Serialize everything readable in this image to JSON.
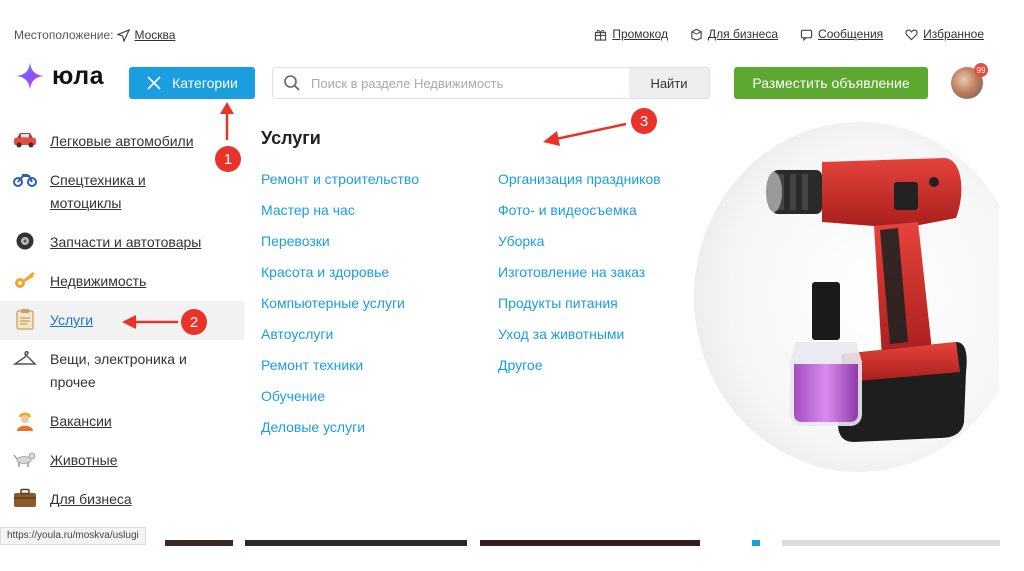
{
  "location": {
    "label": "Местоположение:",
    "city": "Москва"
  },
  "top_links": [
    {
      "label": "Промокод",
      "icon": "gift-icon"
    },
    {
      "label": "Для бизнеса",
      "icon": "briefcase-icon"
    },
    {
      "label": "Сообщения",
      "icon": "message-icon"
    },
    {
      "label": "Избранное",
      "icon": "heart-icon"
    }
  ],
  "header": {
    "logo": "юла",
    "categories_button": "Категории",
    "search_placeholder": "Поиск в разделе Недвижимость",
    "search_value": "",
    "find_button": "Найти",
    "post_button": "Разместить объявление",
    "avatar_badge": "99"
  },
  "sidebar": {
    "items": [
      {
        "label": "Легковые автомобили",
        "icon": "car-icon"
      },
      {
        "label": "Спецтехника и мотоциклы",
        "icon": "motorcycle-icon"
      },
      {
        "label": "Запчасти и автотовары",
        "icon": "tire-icon"
      },
      {
        "label": "Недвижимость",
        "icon": "key-icon"
      },
      {
        "label": "Услуги",
        "icon": "clipboard-icon",
        "active": true
      },
      {
        "label": "Вещи, электроника и прочее",
        "icon": "hanger-icon"
      },
      {
        "label": "Вакансии",
        "icon": "worker-icon"
      },
      {
        "label": "Животные",
        "icon": "dog-icon"
      },
      {
        "label": "Для бизнеса",
        "icon": "briefcase-icon"
      }
    ]
  },
  "category": {
    "title": "Услуги",
    "col1": [
      "Ремонт и строительство",
      "Мастер на час",
      "Перевозки",
      "Красота и здоровье",
      "Компьютерные услуги",
      "Автоуслуги",
      "Ремонт техники",
      "Обучение",
      "Деловые услуги"
    ],
    "col2": [
      "Организация праздников",
      "Фото- и видеосъемка",
      "Уборка",
      "Изготовление на заказ",
      "Продукты питания",
      "Уход за животными",
      "Другое"
    ]
  },
  "annotations": [
    "1",
    "2",
    "3"
  ],
  "status_url": "https://youla.ru/moskva/uslugi",
  "colors": {
    "accent_blue": "#1a9ee0",
    "post_green": "#5ca830",
    "arrow_red": "#e8322a"
  }
}
